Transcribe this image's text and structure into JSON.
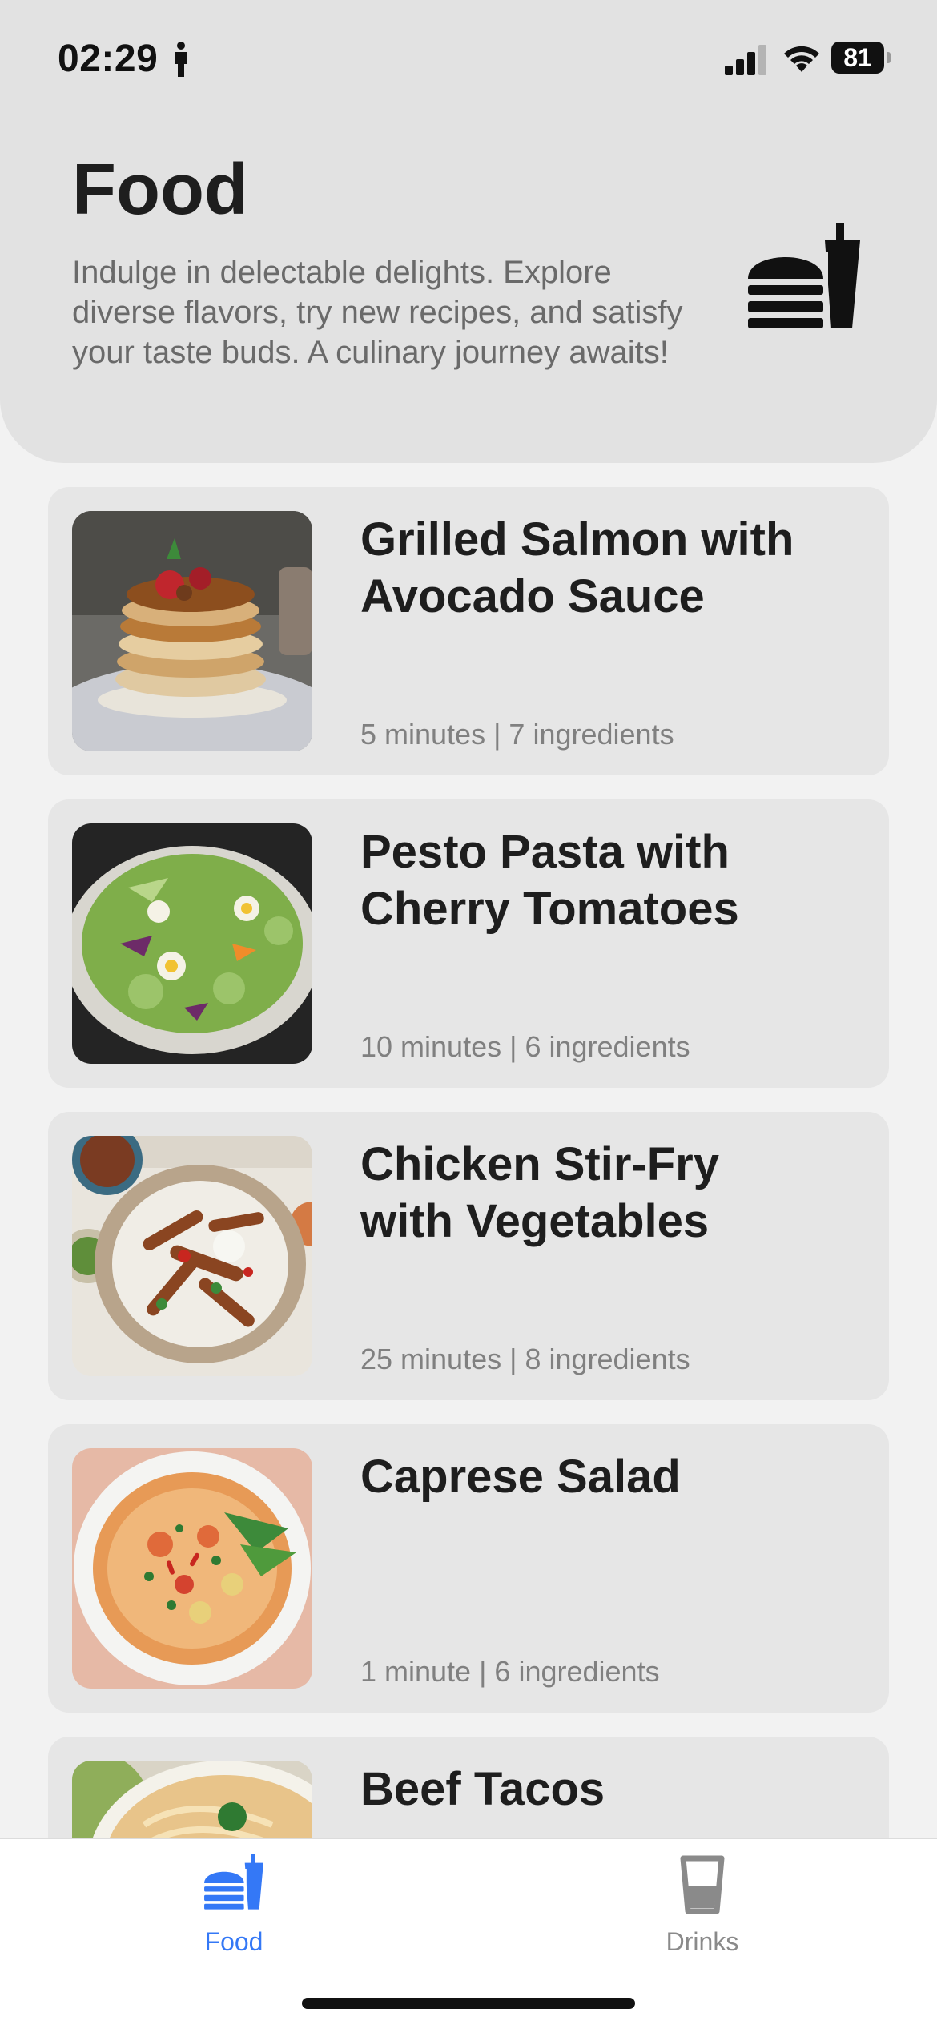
{
  "status_bar": {
    "time": "02:29",
    "battery": "81"
  },
  "header": {
    "title": "Food",
    "description": "Indulge in delectable delights. Explore diverse flavors, try new recipes, and satisfy your taste buds. A culinary journey awaits!",
    "icon": "fastfood-icon"
  },
  "recipes": [
    {
      "title": "Grilled Salmon with Avocado Sauce",
      "meta": "5 minutes | 7 ingredients",
      "image": "pancake-stack-photo"
    },
    {
      "title": "Pesto Pasta with Cherry Tomatoes",
      "meta": "10 minutes | 6 ingredients",
      "image": "green-salad-photo"
    },
    {
      "title": "Chicken Stir-Fry with Vegetables",
      "meta": "25 minutes | 8 ingredients",
      "image": "grilled-chicken-plate-photo"
    },
    {
      "title": "Caprese Salad",
      "meta": "1 minute | 6 ingredients",
      "image": "noodle-soup-bowl-photo"
    },
    {
      "title": "Beef Tacos",
      "meta": "",
      "image": "ramen-bowl-photo"
    }
  ],
  "tab_bar": {
    "tabs": [
      {
        "label": "Food",
        "icon": "fastfood-icon",
        "selected": true
      },
      {
        "label": "Drinks",
        "icon": "cup-icon",
        "selected": false
      }
    ]
  },
  "colors": {
    "accent": "#3478f6",
    "header_bg": "#e2e2e2",
    "card_bg": "#e6e6e6",
    "page_bg": "#f2f2f2"
  }
}
